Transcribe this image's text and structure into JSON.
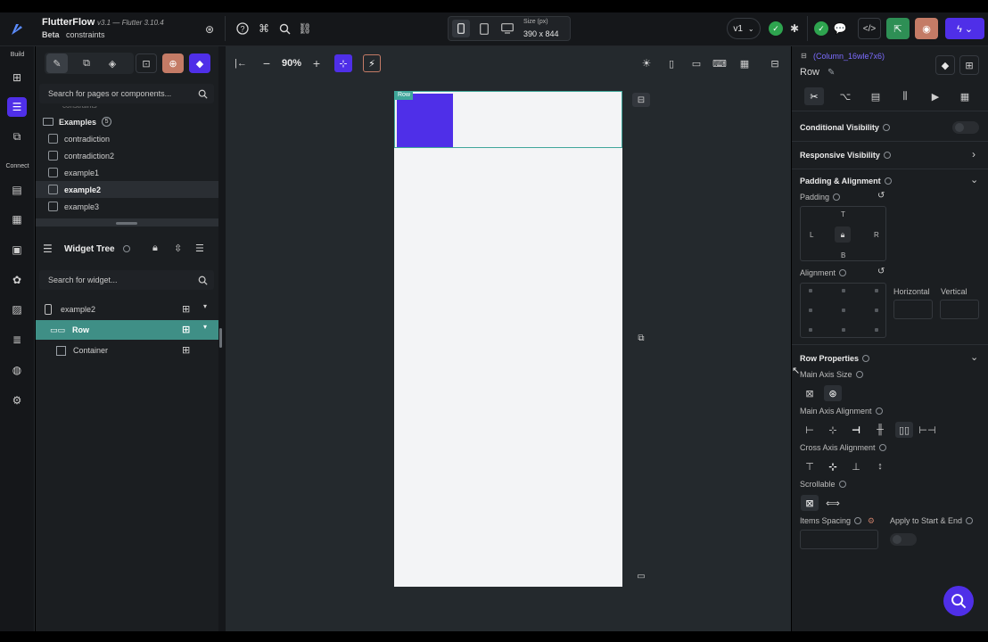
{
  "app": {
    "name": "FlutterFlow",
    "version": "v3.1 — Flutter 3.10.4",
    "beta": "Beta",
    "project": "constraints"
  },
  "topbar": {
    "size_label": "Size (px)",
    "size_value": "390 x 844",
    "version": "v1"
  },
  "rail": {
    "build_label": "Build",
    "connect_label": "Connect"
  },
  "pages": {
    "search_placeholder": "Search for pages or components...",
    "folder_name": "Examples",
    "folder_count": "5",
    "items": [
      "contradiction",
      "contradiction2",
      "example1",
      "example2",
      "example3"
    ],
    "selected": "example2"
  },
  "widget_tree": {
    "title": "Widget Tree",
    "search_placeholder": "Search for widget...",
    "root": "example2",
    "row": "Row",
    "container": "Container"
  },
  "canvas": {
    "zoom": "90%",
    "row_tag": "Row"
  },
  "properties": {
    "widget_id": "(Column_16wle7x6)",
    "widget_type": "Row",
    "conditional_visibility": "Conditional Visibility",
    "responsive_visibility": "Responsive Visibility",
    "padding_alignment": "Padding & Alignment",
    "padding": "Padding",
    "pad_t": "T",
    "pad_l": "L",
    "pad_r": "R",
    "pad_b": "B",
    "alignment": "Alignment",
    "horizontal": "Horizontal",
    "vertical": "Vertical",
    "row_properties": "Row Properties",
    "main_axis_size": "Main Axis Size",
    "main_axis_alignment": "Main Axis Alignment",
    "cross_axis_alignment": "Cross Axis Alignment",
    "scrollable": "Scrollable",
    "items_spacing": "Items Spacing",
    "apply_start_end": "Apply to Start & End"
  },
  "colors": {
    "accent": "#4f2fe8",
    "teal": "#3fa69a",
    "green": "#2ea44f"
  }
}
